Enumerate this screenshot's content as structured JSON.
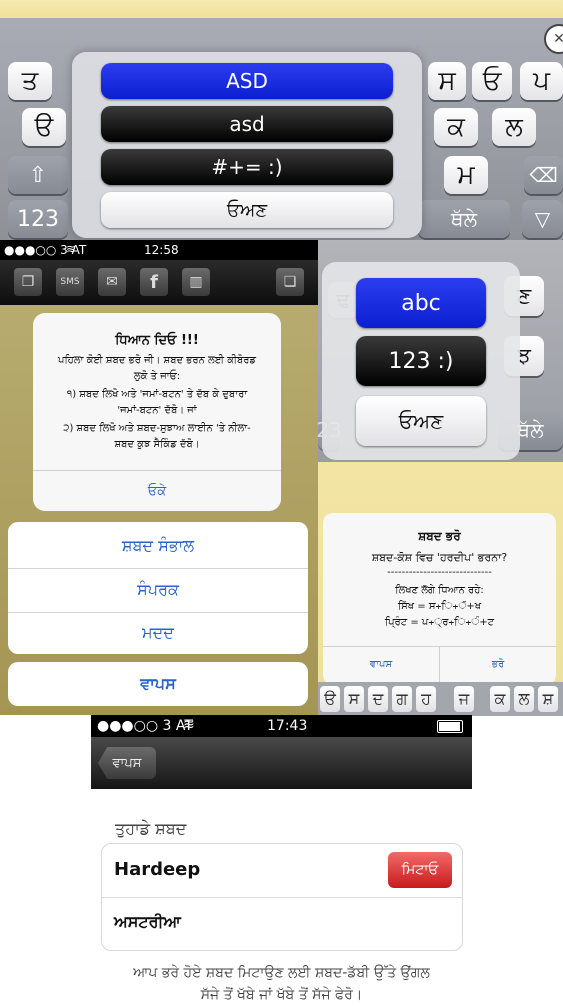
{
  "keyboard_top": {
    "row1": [
      "ਤ",
      "ਸ",
      "ਓ",
      "ਪ"
    ],
    "row2_left": "ੳ",
    "row2_right": [
      "ਕ",
      "ਲ"
    ],
    "row3_left_icon": "shift-icon",
    "row3_right": "ਮ",
    "row3_right_icon": "delete-icon",
    "row4_left": "123",
    "row4_right": "ਥੱਲੇ",
    "row4_right_icon": "down-triangle-icon",
    "popup_buttons": [
      "ASD",
      "asd",
      "#+= :)",
      "ਓਅਣ"
    ]
  },
  "left_screen": {
    "status": {
      "carrier": "●●●○○ 3 AT",
      "time": "12:58"
    },
    "toolbar_icons": [
      "copy-icon",
      "sms-icon",
      "mail-icon",
      "facebook-icon",
      "trash-icon",
      "windows-icon"
    ],
    "alert": {
      "title": "ਧਿਆਨ ਦਿਓ !!!",
      "lines": [
        "ਪਹਿਲਾ ਕੋਈ ਸ਼ਬਦ ਭਰੋ ਜੀ। ਸ਼ਬਦ ਭਰਨ ਲਈ ਕੀਬੋਰਡ",
        "ਲੁਕੋ ਤੇ ਜਾਓ:",
        "੧) ਸ਼ਬਦ ਲਿਖੋ ਅਤੇ 'ਜਮਾਂ-ਬਟਨ' ਤੇ ਦੱਬ ਕੇ ਦੁਬਾਰਾ",
        "'ਜਮਾਂ-ਬਟਨ' ਦੱਬੋ। ਜਾਂ",
        "੨) ਸ਼ਬਦ ਲਿਖੋ ਅਤੇ ਸ਼ਬਦ-ਸੁਝਾਅ ਲਾਈਨ 'ਤੇ ਨੀਲਾ-",
        "ਸ਼ਬਦ ਕੁਝ ਸੈਕਿੰਡ ਦੱਬੋ।"
      ],
      "ok": "ਓਕੇ"
    },
    "menu": [
      "ਸ਼ਬਦ ਸੰਭਾਲ",
      "ਸੰਪਰਕ",
      "ਮਦਦ"
    ],
    "back": "ਵਾਪਸ"
  },
  "right_screen": {
    "popup_buttons": [
      "abc",
      "123 :)",
      "ਓਅਣ"
    ],
    "bg_keys": [
      "ਢ",
      "ਣ",
      "ਝ",
      "ਥੱਲੇ",
      "23"
    ],
    "alert": {
      "title": "ਸ਼ਬਦ ਭਰੋ",
      "line1": "ਸ਼ਬਦ-ਕੋਸ਼ ਵਿਚ 'ਹਰਦੀਪ' ਭਰਨਾ?",
      "dashes": "-----------------------------",
      "line2": "ਲਿਖਣ ਲੱਗੇ ਧਿਆਨ ਰਹੇ:",
      "line3": "ਸਿੱਖ = ਸ+ਿ+ੱ+ਖ",
      "line4": "ਪ੍ਰਿੰਟ = ਪ+੍ਰ+ਿ+ੰ+ਟ",
      "cancel": "ਵਾਪਸ",
      "fill": "ਭਰੋ"
    },
    "key_row": [
      "ੳ",
      "ਸ",
      "ਦ",
      "ਗ",
      "ਹ",
      "ਜ",
      "ਕ",
      "ਲ",
      "ਸ਼"
    ]
  },
  "bottom_screen": {
    "status": {
      "carrier": "●●●○○ 3 AT",
      "time": "17:43"
    },
    "back": "ਵਾਪਸ",
    "section_title": "ਤੁਹਾਡੇ ਸ਼ਬਦ",
    "items": [
      "Hardeep",
      "ਅਸਟਰੀਆ"
    ],
    "delete": "ਮਿਟਾਓ",
    "footer_line1": "ਆਪ ਭਰੇ ਹੋਏ ਸ਼ਬਦ ਮਿਟਾਉਣ ਲਈ ਸ਼ਬਦ-ਡੱਬੀ ਉੱਤੇ ਉਂਗਲ",
    "footer_line2": "ਸੱਜੇ ਤੋਂ ਖੱਬੇ ਜਾਂ ਖੱਬੇ ਤੋਂ ਸੱਜੇ ਫੇਰੋ।"
  }
}
